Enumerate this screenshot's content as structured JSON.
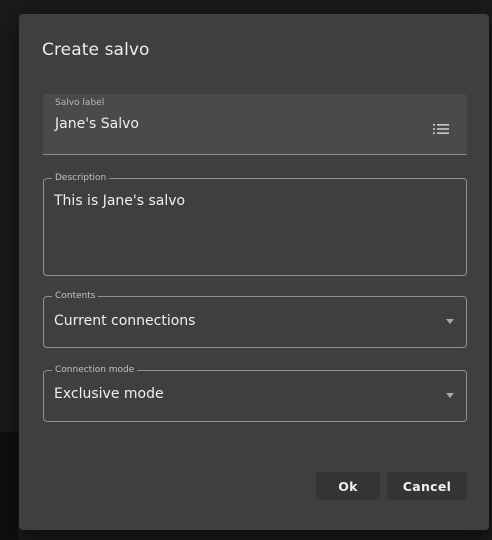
{
  "dialog": {
    "title": "Create salvo",
    "salvo_label": {
      "label": "Salvo label",
      "value": "Jane's Salvo",
      "icon": "list-icon"
    },
    "description": {
      "label": "Description",
      "value": "This is Jane's salvo"
    },
    "contents": {
      "label": "Contents",
      "selected": "Current connections",
      "icon": "chevron-down-icon"
    },
    "connection_mode": {
      "label": "Connection mode",
      "selected": "Exclusive mode",
      "icon": "chevron-down-icon"
    },
    "buttons": {
      "ok": "Ok",
      "cancel": "Cancel"
    }
  },
  "colors": {
    "dialog_bg": "#3f3f3f",
    "field_bg": "#4a4a4a",
    "text": "#f0f0f0",
    "button_bg": "#343434"
  }
}
